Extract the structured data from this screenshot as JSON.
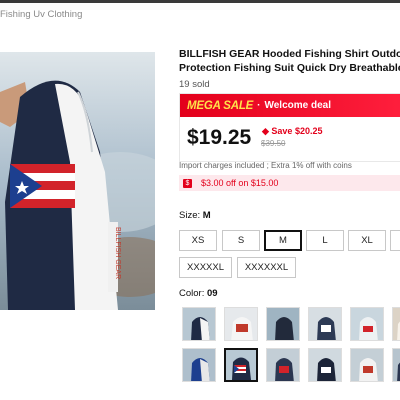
{
  "breadcrumb": {
    "text": "Fishing Uv Clothing"
  },
  "product": {
    "title_line1": "BILLFISH GEAR Hooded Fishing Shirt Outdoor Sunscreen",
    "title_line2": "Protection Fishing Suit Quick Dry Breathable TOPS",
    "sold": "19 sold"
  },
  "sale": {
    "mega_label": "MEGA SALE",
    "separator": "·",
    "deal_label": "Welcome deal",
    "price": "$19.25",
    "save": "Save $20.25",
    "original_price": "$39.50",
    "import_note": "Import charges included ; Extra 1% off with coins",
    "coupon_icon": "$",
    "coupon_text": "$3.00 off on $15.00"
  },
  "size": {
    "label": "Size:",
    "selected_value": "M",
    "options": [
      "XS",
      "S",
      "M",
      "L",
      "XL",
      "",
      "XXXXXL",
      "XXXXXXL"
    ]
  },
  "color": {
    "label": "Color:",
    "selected_value": "09",
    "selected_index": 6
  },
  "colors": {
    "sale_red": "#e3001b",
    "mega_yellow": "#ffe24a",
    "coupon_bg": "#fde8ec"
  }
}
